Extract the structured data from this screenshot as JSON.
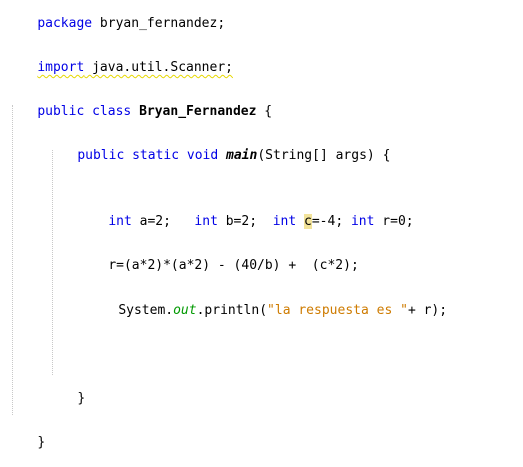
{
  "code": {
    "line_package": {
      "kw": "package",
      "rest": " bryan_fernandez;"
    },
    "line_import": {
      "kw": "import",
      "rest": " java.util.Scanner;"
    },
    "line_class": {
      "kw": "public class",
      "sp": " ",
      "name": "Bryan_Fernandez",
      "rest": " {"
    },
    "line_main": {
      "kw": "public static void",
      "sp": " ",
      "name": "main",
      "rest": "(String[] args) {"
    },
    "line_decl": {
      "int1": "int",
      "a": " a=2;   ",
      "int2": "int",
      "b": " b=2;  ",
      "int3": "int",
      "sp": " ",
      "c_char": "c",
      "c_rest": "=-4; ",
      "int4": "int",
      "r": " r=0;"
    },
    "line_expr": "r=(a*2)*(a*2) - (40/b) +  (c*2);",
    "line_print": {
      "pre": "System.",
      "field": "out",
      "mid": ".println(",
      "str": "\"la respuesta es \"",
      "end": "+ r);"
    },
    "brace_method": "}",
    "brace_class": "}"
  }
}
